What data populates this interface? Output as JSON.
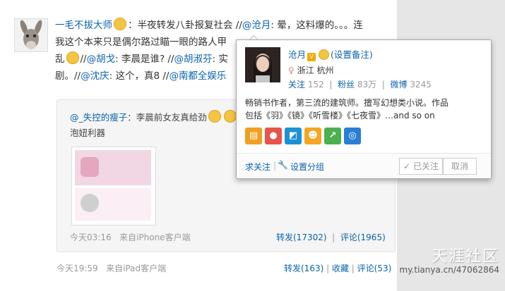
{
  "post": {
    "author": "一毛不拔大师",
    "text_1": "：半夜转发八卦报复社会 //",
    "mention_1": "@沧月",
    "text_2": ": 晕，这料爆的。。。连",
    "line2": "我这个本来只是偶尔路过瞄一眼的路人甲",
    "line3_prefix": "乱",
    "mention_2": "@胡戈",
    "text_3": ": 李晨是谁? //",
    "mention_3": "@胡淑芬",
    "text_4": ": 实",
    "line4_prefix": "剧。//",
    "mention_4": "@沈庆",
    "text_5": ": 这个，真8 //",
    "mention_5": "@南都全娱乐"
  },
  "repost": {
    "author": "@_失控的瘦子",
    "text": "：李晨前女友真给劲",
    "text2": "泡妞利器",
    "time": "今天03:16",
    "source_prefix": "来自",
    "source": "iPhone客户端",
    "forward": "转发(17302)",
    "comment": "评论(1965)"
  },
  "footer": {
    "time": "今天19:59",
    "source_prefix": "来自",
    "source": "iPad客户端",
    "forward": "转发(163)",
    "fav": "收藏",
    "comment": "评论(53)"
  },
  "card": {
    "name": "沧月",
    "remark": "(设置备注)",
    "location": "浙江 杭州",
    "follow_label": "关注",
    "follow_count": "152",
    "fans_label": "粉丝",
    "fans_count": "83万",
    "weibo_label": "微博",
    "weibo_count": "3245",
    "bio1": "畅销书作者，第三流的建筑师。擅写幻想类小说。作品",
    "bio2": "包括《羽》《镜》《听雪楼》《七夜雪》…and so on",
    "unfollow": "求关注",
    "group": "设置分组",
    "followed": "已关注",
    "cancel": "取消"
  },
  "watermark": {
    "text": "天涯社区",
    "url": "my.tianya.cn/47062864"
  },
  "colors": {
    "link": "#0a62ad",
    "muted": "#999999"
  }
}
